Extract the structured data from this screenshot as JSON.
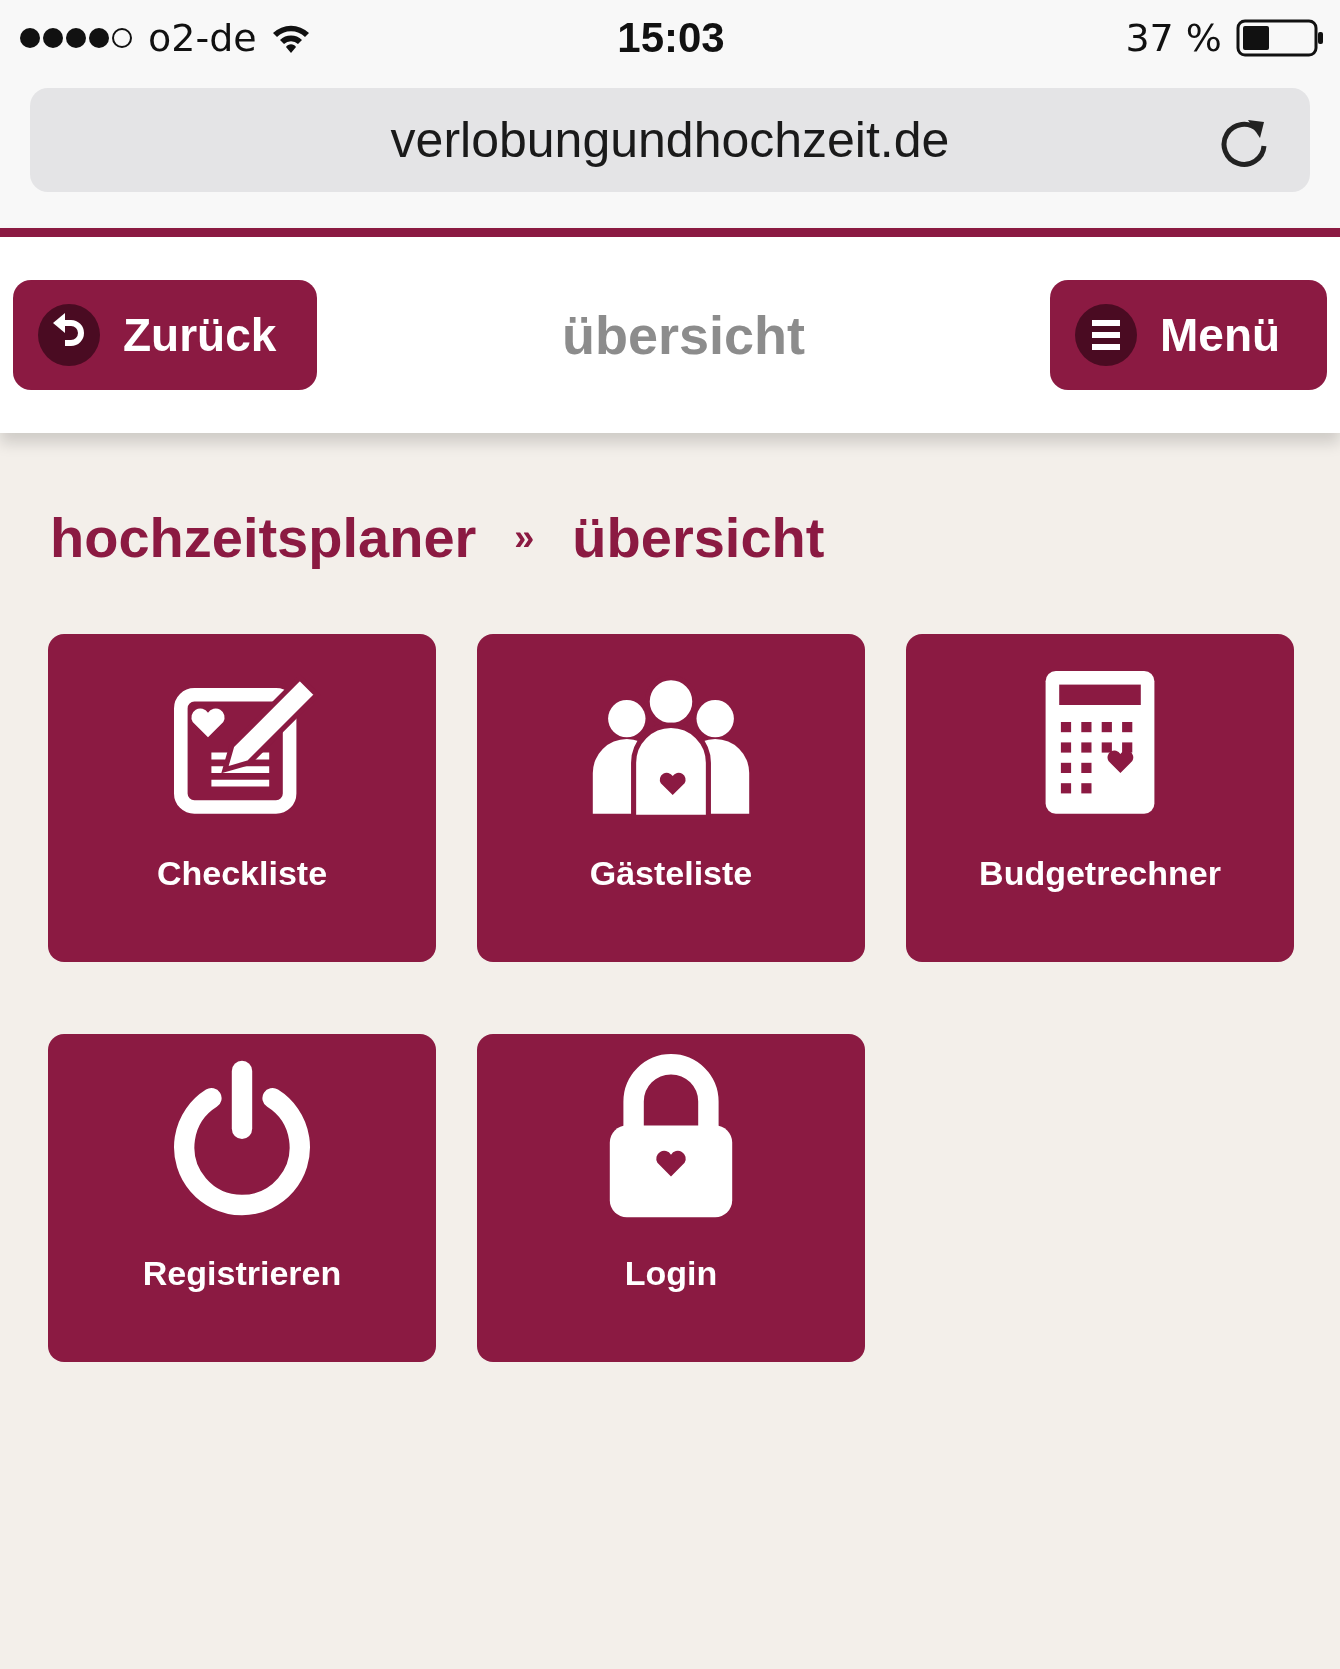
{
  "status_bar": {
    "carrier": "o2-de",
    "time": "15:03",
    "battery": "37 %"
  },
  "address_bar": {
    "url": "verlobungundhochzeit.de"
  },
  "header": {
    "back_button": "Zurück",
    "title": "übersicht",
    "menu_button": "Menü"
  },
  "breadcrumb": {
    "items": [
      "hochzeitsplaner",
      "übersicht"
    ],
    "separator": "»"
  },
  "tiles": [
    {
      "label": "Checkliste",
      "kind": "checklist"
    },
    {
      "label": "Gästeliste",
      "kind": "guests"
    },
    {
      "label": "Budgetrechner",
      "kind": "calculator"
    },
    {
      "label": "Registrieren",
      "kind": "power"
    },
    {
      "label": "Login",
      "kind": "lock"
    }
  ]
}
